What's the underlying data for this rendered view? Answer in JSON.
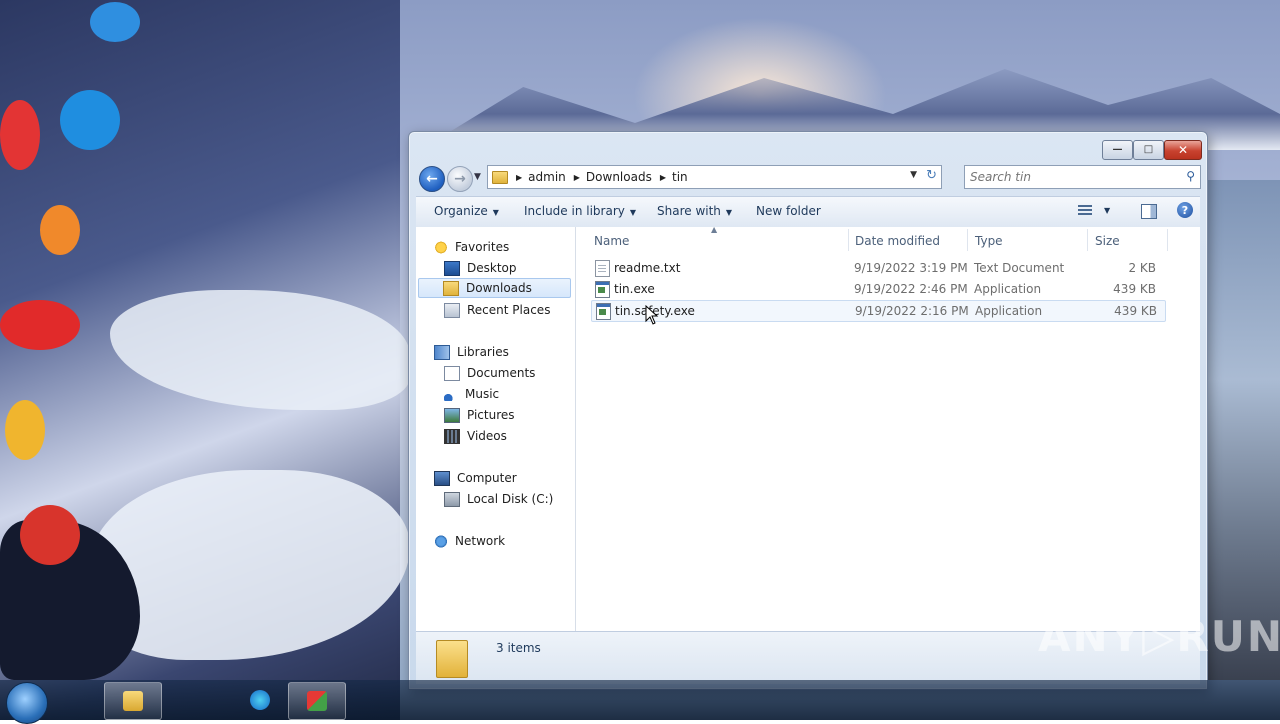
{
  "window": {
    "controls": {
      "minimize": "—",
      "maximize": "□",
      "close": "✕"
    },
    "nav": {
      "back": "←",
      "forward": "→",
      "history": "▼"
    },
    "address": {
      "crumbs": [
        "admin",
        "Downloads",
        "tin"
      ],
      "separator": "▶",
      "dropdown": "▼",
      "refresh": "↻"
    },
    "search": {
      "placeholder": "Search tin",
      "icon": "⚲"
    }
  },
  "toolbar": {
    "organize": "Organize",
    "include_in_library": "Include in library",
    "share_with": "Share with",
    "new_folder": "New folder",
    "caret": "▼",
    "help": "?"
  },
  "sidebar": {
    "favorites": {
      "label": "Favorites",
      "items": [
        "Desktop",
        "Downloads",
        "Recent Places"
      ]
    },
    "libraries": {
      "label": "Libraries",
      "items": [
        "Documents",
        "Music",
        "Pictures",
        "Videos"
      ]
    },
    "computer": {
      "label": "Computer",
      "items": [
        "Local Disk (C:)"
      ]
    },
    "network": {
      "label": "Network"
    },
    "selected": "Downloads"
  },
  "columns": {
    "name": "Name",
    "date_modified": "Date modified",
    "type": "Type",
    "size": "Size",
    "sort_indicator": "▲"
  },
  "files": [
    {
      "name": "readme.txt",
      "date": "9/19/2022 3:19 PM",
      "type": "Text Document",
      "size": "2 KB",
      "icon": "text-file-icon"
    },
    {
      "name": "tin.exe",
      "date": "9/19/2022 2:46 PM",
      "type": "Application",
      "size": "439 KB",
      "icon": "application-icon"
    },
    {
      "name": "tin.safety.exe",
      "date": "9/19/2022 2:16 PM",
      "type": "Application",
      "size": "439 KB",
      "icon": "application-icon"
    }
  ],
  "status": {
    "item_count": "3 items"
  },
  "watermark": "ANY▷RUN",
  "colors": {
    "accent": "#1e395b",
    "selection": "#d6e7fb",
    "close": "#c8422f"
  }
}
